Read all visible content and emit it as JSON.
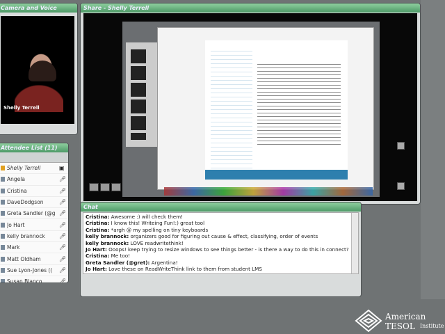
{
  "camera": {
    "title": "Camera and Voice",
    "presenter_name": "Shelly Terrell"
  },
  "share": {
    "title": "Share - Shelly Terrell"
  },
  "attendees": {
    "title": "Attendee List (11)",
    "items": [
      "Shelly Terrell",
      "Angela",
      "Cristina",
      "DaveDodgson",
      "Greta Sandler (@g",
      "Jo Hart",
      "kelly brannock",
      "Mark",
      "Matt Oldham",
      "Sue Lyon-Jones ((",
      "Susan Blanco"
    ]
  },
  "chat": {
    "title": "Chat",
    "messages": [
      {
        "from": "Cristina:",
        "text": " Awesome :) will check them!"
      },
      {
        "from": "Cristina:",
        "text": " I know this! Writeing Fun!:) great tool"
      },
      {
        "from": "Cristina:",
        "text": " *argh @ my spelling on tiny keyboards"
      },
      {
        "from": "kelly brannock:",
        "text": " organizers good for figuring out cause & effect, classifying, order of events"
      },
      {
        "from": "kelly brannock:",
        "text": " LOVE readwritethink!"
      },
      {
        "from": "Jo Hart:",
        "text": " Ooops! keep trying to resize windows to see things better - is there a way to do this in connect?"
      },
      {
        "from": "Cristina:",
        "text": " Me too!"
      },
      {
        "from": "Greta Sandler (@gret):",
        "text": " Argentina!"
      },
      {
        "from": "Jo Hart:",
        "text": " Love these on ReadWriteThink link to them from student LMS"
      }
    ]
  },
  "logo": {
    "name": "American TESOL",
    "sub": "Institute"
  }
}
